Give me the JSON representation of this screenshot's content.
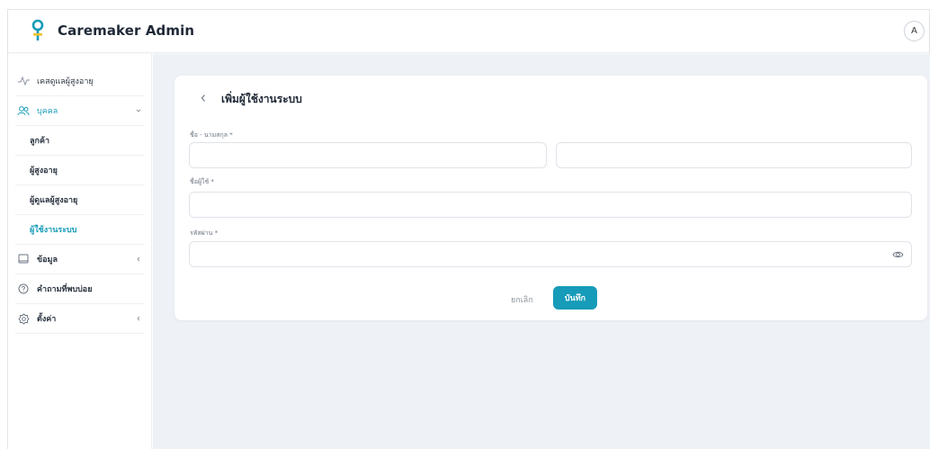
{
  "app": {
    "title": "Caremaker Admin",
    "avatar_letter": "A",
    "accent": "#169bb8"
  },
  "sidebar": {
    "items": [
      {
        "label": "เคสดูแลผู้สูงอายุ",
        "icon": "activity-icon"
      },
      {
        "label": "บุคคล",
        "icon": "users-icon",
        "expanded": true
      },
      {
        "label": "ลูกค้า"
      },
      {
        "label": "ผู้สูงอายุ"
      },
      {
        "label": "ผู้ดูแลผู้สูงอายุ"
      },
      {
        "label": "ผู้ใช้งานระบบ",
        "current": true
      },
      {
        "label": "ข้อมูล",
        "icon": "monitor-icon"
      },
      {
        "label": "คำถามที่พบบ่อย",
        "icon": "help-circle-icon"
      },
      {
        "label": "ตั้งค่า",
        "icon": "settings-icon"
      }
    ]
  },
  "form": {
    "title": "เพิ่มผู้ใช้งานระบบ",
    "fullname_label": "ชื่อ - นามสกุล *",
    "fullname_first_value": "",
    "fullname_last_value": "",
    "username_label": "ชื่อผู้ใช้ *",
    "username_value": "",
    "password_label": "รหัสผ่าน *",
    "password_value": "",
    "cancel_label": "ยกเลิก",
    "save_label": "บันทึก"
  }
}
